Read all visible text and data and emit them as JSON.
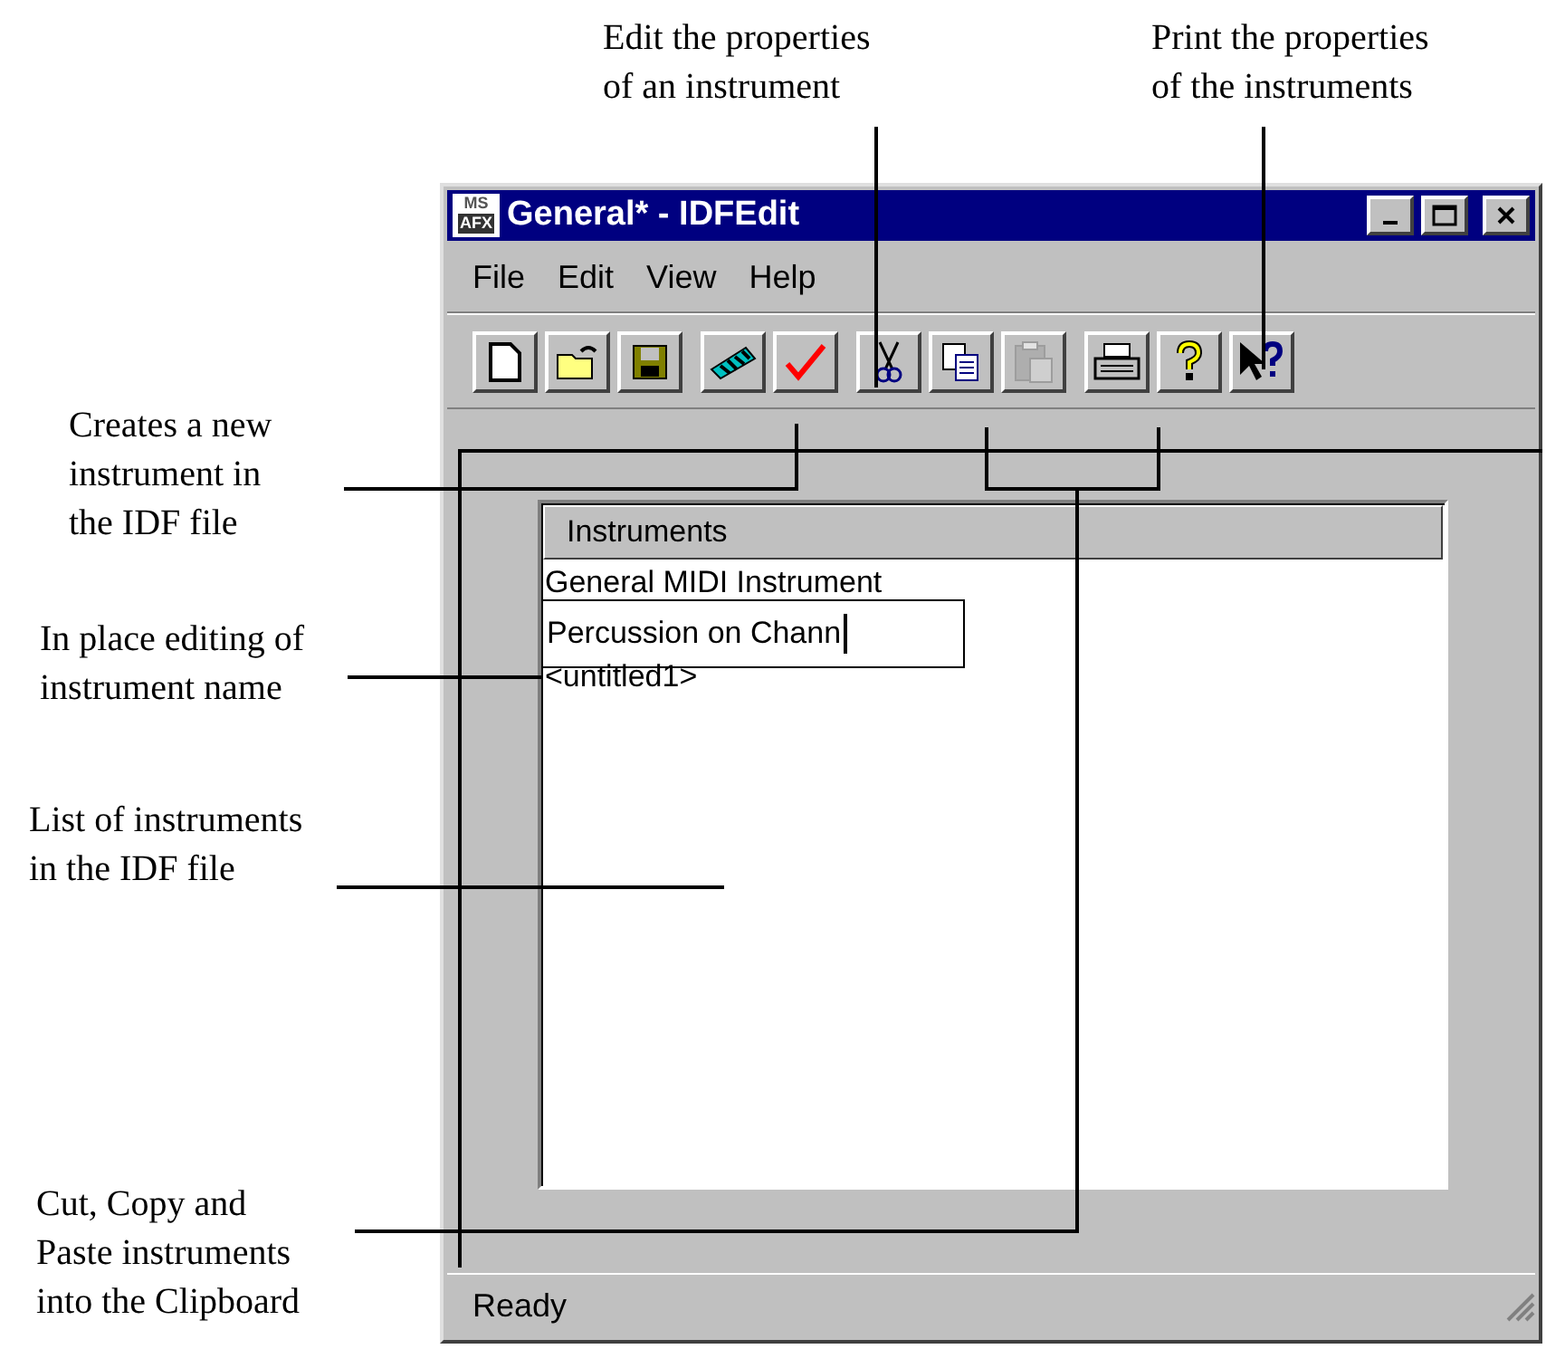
{
  "callouts": [
    {
      "lines": [
        "Edit the properties",
        "of an instrument"
      ]
    },
    {
      "lines": [
        "Print the properties",
        "of the instruments"
      ]
    },
    {
      "lines": [
        "Creates a new",
        "instrument in",
        "the IDF file"
      ]
    },
    {
      "lines": [
        "In place editing of",
        "instrument name"
      ]
    },
    {
      "lines": [
        "List of instruments",
        "in the IDF file"
      ]
    },
    {
      "lines": [
        "Cut, Copy and",
        "Paste instruments",
        "into the Clipboard"
      ]
    }
  ],
  "window": {
    "title": "General* - IDFEdit",
    "app_icon": [
      "MS",
      "AFX"
    ],
    "menu": [
      "File",
      "Edit",
      "View",
      "Help"
    ],
    "toolbar": [
      [
        {
          "kind": "new",
          "disabled": false
        },
        {
          "kind": "open",
          "disabled": false
        },
        {
          "kind": "save",
          "disabled": false
        }
      ],
      [
        {
          "kind": "instrument",
          "disabled": false
        },
        {
          "kind": "edit",
          "disabled": false
        }
      ],
      [
        {
          "kind": "cut",
          "disabled": false
        },
        {
          "kind": "copy",
          "disabled": false
        },
        {
          "kind": "paste",
          "disabled": true
        }
      ],
      [
        {
          "kind": "print",
          "disabled": false
        },
        {
          "kind": "help",
          "disabled": false
        },
        {
          "kind": "context-help",
          "disabled": false
        }
      ]
    ],
    "list": {
      "header": "Instruments",
      "items": [
        {
          "name": "General MIDI Instrument",
          "editing": false
        },
        {
          "name": "Percussion on Chann",
          "editing": true
        },
        {
          "name": "<untitled1>",
          "editing": false
        }
      ]
    },
    "status_bar": "Ready"
  }
}
